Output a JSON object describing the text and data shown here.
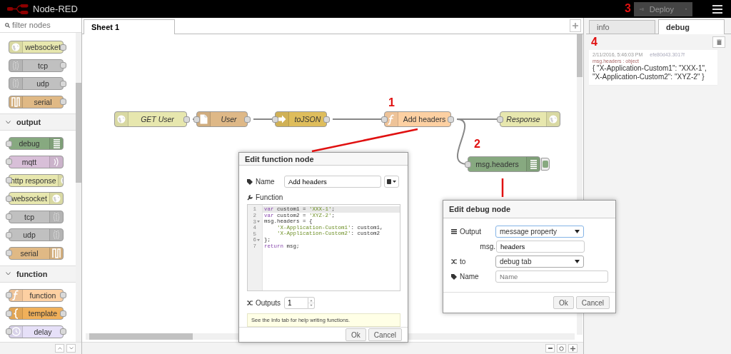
{
  "header": {
    "title": "Node-RED",
    "deploy": {
      "label": "Deploy",
      "disabled": true
    }
  },
  "palette": {
    "filter_placeholder": "filter nodes",
    "categories": [
      {
        "nodes": [
          {
            "label": "websocket",
            "kind": "websocket",
            "has_input": false,
            "has_output": true,
            "color": "#e7e7ae"
          },
          {
            "label": "tcp",
            "kind": "tcp",
            "has_input": false,
            "has_output": true,
            "color": "#c0c0c0"
          },
          {
            "label": "udp",
            "kind": "udp",
            "has_input": false,
            "has_output": true,
            "color": "#c0c0c0"
          },
          {
            "label": "serial",
            "kind": "serial",
            "has_input": false,
            "has_output": true,
            "color": "#e0b985"
          }
        ]
      },
      {
        "name": "output",
        "expanded": true,
        "nodes": [
          {
            "label": "debug",
            "kind": "debug",
            "has_input": true,
            "has_output": false,
            "color": "#87a980"
          },
          {
            "label": "mqtt",
            "kind": "mqtt",
            "has_input": true,
            "has_output": false,
            "color": "#d8bfd8"
          },
          {
            "label": "http response",
            "kind": "http",
            "has_input": true,
            "has_output": false,
            "color": "#e7e7ae"
          },
          {
            "label": "websocket",
            "kind": "websocket",
            "has_input": true,
            "has_output": false,
            "color": "#e7e7ae"
          },
          {
            "label": "tcp",
            "kind": "tcp",
            "has_input": true,
            "has_output": false,
            "color": "#c0c0c0"
          },
          {
            "label": "udp",
            "kind": "udp",
            "has_input": true,
            "has_output": false,
            "color": "#c0c0c0"
          },
          {
            "label": "serial",
            "kind": "serial",
            "has_input": true,
            "has_output": false,
            "color": "#e0b985"
          }
        ]
      },
      {
        "name": "function",
        "expanded": true,
        "nodes": [
          {
            "label": "function",
            "kind": "function",
            "has_input": true,
            "has_output": true,
            "color": "#fdd0a2"
          },
          {
            "label": "template",
            "kind": "template",
            "has_input": true,
            "has_output": true,
            "color": "#f0b05a"
          },
          {
            "label": "delay",
            "kind": "delay",
            "has_input": true,
            "has_output": true,
            "color": "#e6e0f8"
          }
        ]
      }
    ]
  },
  "workspace": {
    "tabs": [
      {
        "label": "Sheet 1",
        "selected": true
      }
    ]
  },
  "canvas": {
    "nodes": [
      {
        "label": "GET User",
        "kind": "http",
        "has_input": false,
        "has_output": true,
        "named": true,
        "color": "#e7e7ae"
      },
      {
        "label": "User",
        "kind": "file",
        "has_input": true,
        "has_output": true,
        "named": true,
        "color": "#deb887"
      },
      {
        "label": "toJSON",
        "kind": "json",
        "has_input": true,
        "has_output": true,
        "named": true,
        "color": "#debd5c"
      },
      {
        "label": "Add headers",
        "kind": "function",
        "has_input": true,
        "has_output": true,
        "named": false,
        "color": "#fdd0a2"
      },
      {
        "label": "Response",
        "kind": "http",
        "has_input": true,
        "has_output": false,
        "named": true,
        "color": "#e7e7ae"
      },
      {
        "label": "msg.headers",
        "kind": "debug",
        "has_input": true,
        "has_output": false,
        "named": false,
        "color": "#87a980",
        "button_active": true
      }
    ]
  },
  "function_dialog": {
    "title": "Edit function node",
    "name_label": "Name",
    "name_value": "Add headers",
    "function_label": "Function",
    "code": [
      {
        "number": "1",
        "fold": false,
        "indent": false,
        "highlighted": true,
        "tokens": [
          {
            "kind": "keyword",
            "text": "var"
          },
          {
            "kind": "plain",
            "text": " custom1 = "
          },
          {
            "kind": "string",
            "text": "'XXX-1'"
          },
          {
            "kind": "plain",
            "text": ";"
          }
        ]
      },
      {
        "number": "2",
        "fold": false,
        "indent": false,
        "highlighted": false,
        "tokens": [
          {
            "kind": "keyword",
            "text": "var"
          },
          {
            "kind": "plain",
            "text": " custom2 = "
          },
          {
            "kind": "string",
            "text": "'XYZ-2'"
          },
          {
            "kind": "plain",
            "text": ";"
          }
        ]
      },
      {
        "number": "3",
        "fold": true,
        "indent": false,
        "highlighted": false,
        "tokens": [
          {
            "kind": "plain",
            "text": "msg.headers = {"
          }
        ]
      },
      {
        "number": "4",
        "fold": false,
        "indent": true,
        "highlighted": false,
        "tokens": [
          {
            "kind": "string",
            "text": "'X-Application-Custom1'"
          },
          {
            "kind": "plain",
            "text": ": custom1,"
          }
        ]
      },
      {
        "number": "5",
        "fold": false,
        "indent": true,
        "highlighted": false,
        "tokens": [
          {
            "kind": "string",
            "text": "'X-Application-Custom2'"
          },
          {
            "kind": "plain",
            "text": ": custom2"
          }
        ]
      },
      {
        "number": "6",
        "fold": true,
        "indent": false,
        "highlighted": false,
        "tokens": [
          {
            "kind": "plain",
            "text": "};"
          }
        ]
      },
      {
        "number": "7",
        "fold": false,
        "indent": false,
        "highlighted": false,
        "tokens": [
          {
            "kind": "keyword",
            "text": "return"
          },
          {
            "kind": "plain",
            "text": " msg;"
          }
        ]
      }
    ],
    "outputs_label": "Outputs",
    "outputs_value": "1",
    "tip": "See the Info tab for help writing functions.",
    "buttons": [
      "Ok",
      "Cancel"
    ]
  },
  "debug_dialog": {
    "title": "Edit debug node",
    "output_label": "Output",
    "output_value": "message property",
    "prefix": "msg.",
    "property_value": "headers",
    "to_label": "to",
    "to_value": "debug tab",
    "name_label": "Name",
    "name_placeholder": "Name",
    "buttons": [
      "Ok",
      "Cancel"
    ]
  },
  "sidebar": {
    "tabs": [
      {
        "label": "info",
        "selected": false
      },
      {
        "label": "debug",
        "selected": true
      }
    ],
    "messages": [
      {
        "time": "2/11/2016, 5:46:03 PM",
        "node_id": "efe80d43.3017f",
        "topic": "msg.headers : object",
        "payload": "{ \"X-Application-Custom1\": \"XXX-1\", \"X-Application-Custom2\": \"XYZ-2\" }"
      }
    ]
  },
  "annotations": [
    {
      "label": "1"
    },
    {
      "label": "2"
    },
    {
      "label": "3"
    },
    {
      "label": "4"
    }
  ]
}
